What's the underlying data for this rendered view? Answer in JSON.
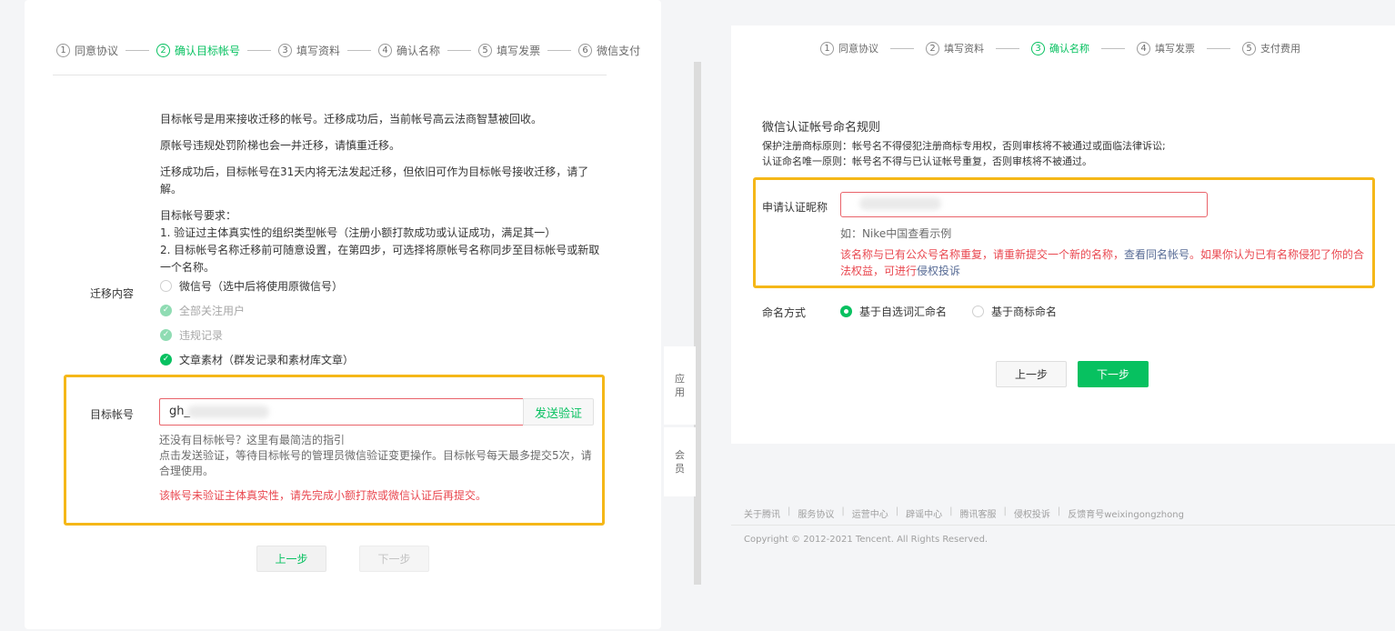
{
  "left": {
    "steps": [
      {
        "num": "1",
        "label": "同意协议",
        "active": false
      },
      {
        "num": "2",
        "label": "确认目标帐号",
        "active": true
      },
      {
        "num": "3",
        "label": "填写资料",
        "active": false
      },
      {
        "num": "4",
        "label": "确认名称",
        "active": false
      },
      {
        "num": "5",
        "label": "填写发票",
        "active": false
      },
      {
        "num": "6",
        "label": "微信支付",
        "active": false
      }
    ],
    "notes": {
      "p1": "目标帐号是用来接收迁移的帐号。迁移成功后，当前帐号高云法商智慧被回收。",
      "p2": "原帐号违规处罚阶梯也会一并迁移，请慎重迁移。",
      "p3": "迁移成功后，目标帐号在31天内将无法发起迁移，但依旧可作为目标帐号接收迁移，请了解。",
      "req_title": "目标帐号要求：",
      "req_1": "1. 验证过主体真实性的组织类型帐号（注册小额打款成功或认证成功，满足其一）",
      "req_2": "2. 目标帐号名称迁移前可随意设置，在第四步，可选择将原帐号名称同步至目标帐号或新取一个名称。"
    },
    "migrate_label": "迁移内容",
    "options": {
      "wechat_id": "微信号（选中后将使用原微信号）",
      "followers": "全部关注用户",
      "violations": "违规记录",
      "articles": "文章素材（群发记录和素材库文章）"
    },
    "target_label": "目标帐号",
    "target_value": "gh_",
    "verify_button": "发送验证",
    "help_line1": "还没有目标帐号？这里有最简洁的指引",
    "help_line2": "点击发送验证，等待目标帐号的管理员微信验证变更操作。目标帐号每天最多提交5次，请合理使用。",
    "error": "该帐号未验证主体真实性，请先完成小额打款或微信认证后再提交。",
    "prev_button": "上一步",
    "next_button": "下一步"
  },
  "side_tabs": {
    "app_1": "应",
    "app_2": "用",
    "vip_1": "会",
    "vip_2": "员"
  },
  "right": {
    "steps": [
      {
        "num": "1",
        "label": "同意协议",
        "active": false
      },
      {
        "num": "2",
        "label": "填写资料",
        "active": false
      },
      {
        "num": "3",
        "label": "确认名称",
        "active": true
      },
      {
        "num": "4",
        "label": "填写发票",
        "active": false
      },
      {
        "num": "5",
        "label": "支付费用",
        "active": false
      }
    ],
    "rules_title": "微信认证帐号命名规则",
    "rule_1": "保护注册商标原则：帐号名不得侵犯注册商标专用权，否则审核将不被通过或面临法律诉讼;",
    "rule_2": "认证命名唯一原则：帐号名不得与已认证帐号重复，否则审核将不被通过。",
    "nickname_label": "申请认证昵称",
    "example": "如：Nike中国查看示例",
    "error_part1": "该名称与已有公众号名称重复，请重新提交一个新的名称，",
    "error_link1": "查看同名帐号",
    "error_part2": "。如果你认为已有名称侵犯了你的合法权益，可进行",
    "error_link2": "侵权投诉",
    "naming_label": "命名方式",
    "naming_option1": "基于自选词汇命名",
    "naming_option2": "基于商标命名",
    "prev_button": "上一步",
    "next_button": "下一步",
    "footer_links": [
      "关于腾讯",
      "服务协议",
      "运营中心",
      "辟谣中心",
      "腾讯客服",
      "侵权投诉",
      "反馈育号weixingongzhong"
    ],
    "copyright": "Copyright © 2012-2021 Tencent. All Rights Reserved."
  },
  "colors": {
    "accent_green": "#07c160",
    "error_red": "#e9474f",
    "highlight_yellow": "#f5b718",
    "link_blue": "#576b95"
  }
}
